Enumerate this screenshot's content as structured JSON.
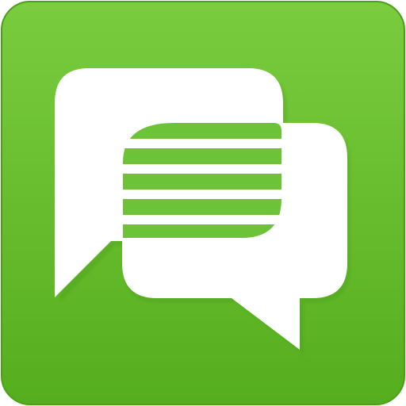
{
  "icon": {
    "semantic": "chat-bubbles-icon",
    "colors": {
      "background_top": "#7ACC3E",
      "background_bottom": "#55AE1E",
      "background_edge": "#4C9F1A",
      "bubble_fill": "#FFFFFF",
      "stripe_fill": "#6CC338",
      "shadow": "#3F8F12"
    }
  }
}
